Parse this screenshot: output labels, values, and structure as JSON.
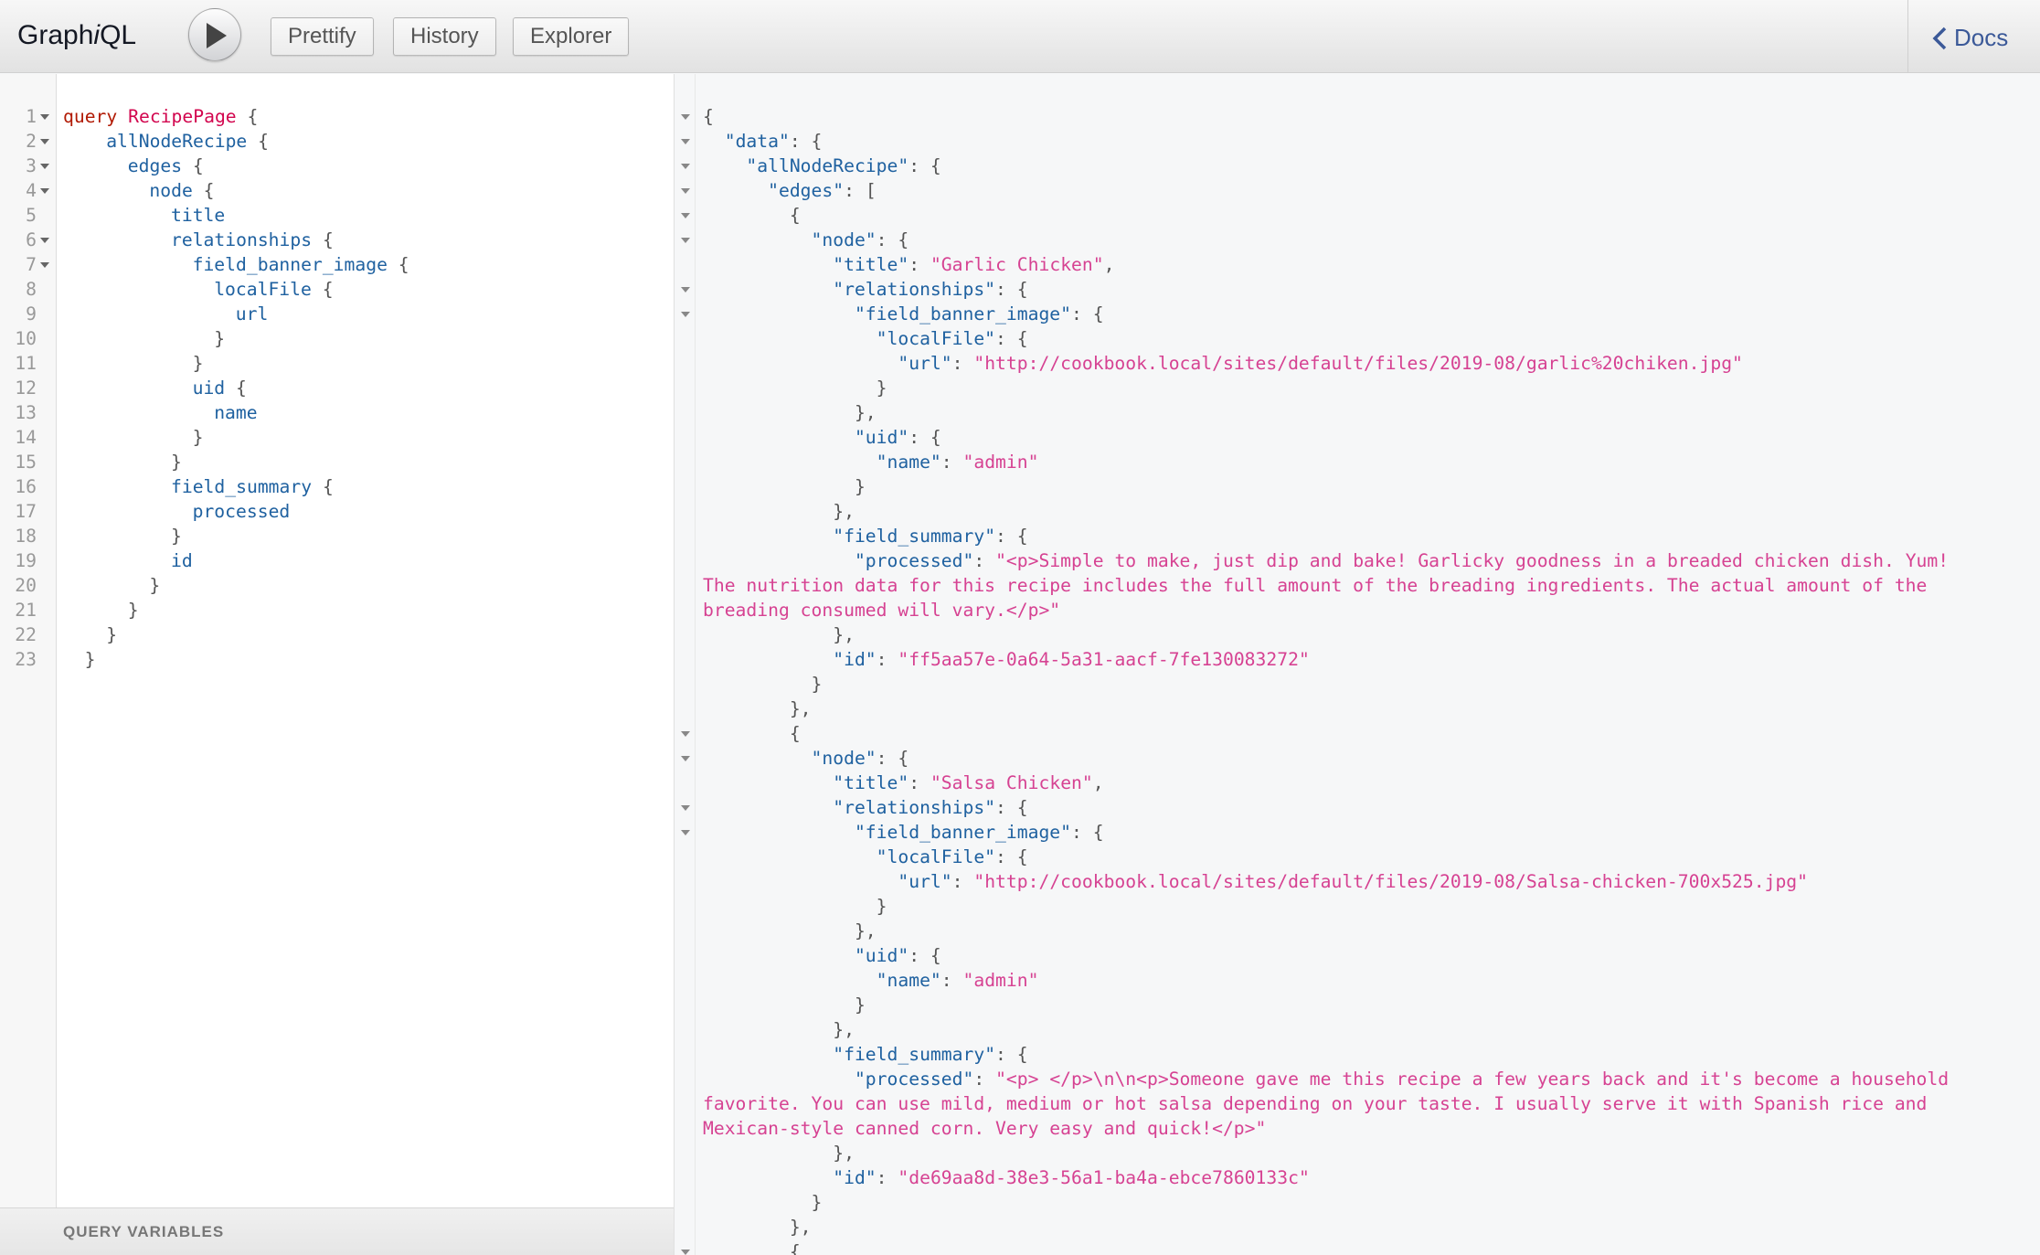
{
  "toolbar": {
    "logo_prefix": "Graph",
    "logo_italic": "i",
    "logo_suffix": "QL",
    "prettify": "Prettify",
    "history": "History",
    "explorer": "Explorer",
    "docs": "Docs"
  },
  "query_lines": [
    {
      "n": "1",
      "fold": true,
      "indent": 0,
      "parts": [
        {
          "t": "query",
          "c": "kw"
        },
        {
          "t": " "
        },
        {
          "t": "RecipePage",
          "c": "def"
        },
        {
          "t": " {"
        }
      ]
    },
    {
      "n": "2",
      "fold": true,
      "indent": 2,
      "parts": [
        {
          "t": "allNodeRecipe",
          "c": "prop"
        },
        {
          "t": " {"
        }
      ]
    },
    {
      "n": "3",
      "fold": true,
      "indent": 3,
      "parts": [
        {
          "t": "edges",
          "c": "prop"
        },
        {
          "t": " {"
        }
      ]
    },
    {
      "n": "4",
      "fold": true,
      "indent": 4,
      "parts": [
        {
          "t": "node",
          "c": "prop"
        },
        {
          "t": " {"
        }
      ]
    },
    {
      "n": "5",
      "fold": false,
      "indent": 5,
      "parts": [
        {
          "t": "title",
          "c": "prop"
        }
      ]
    },
    {
      "n": "6",
      "fold": true,
      "indent": 5,
      "parts": [
        {
          "t": "relationships",
          "c": "prop"
        },
        {
          "t": " {"
        }
      ]
    },
    {
      "n": "7",
      "fold": true,
      "indent": 6,
      "parts": [
        {
          "t": "field_banner_image",
          "c": "prop"
        },
        {
          "t": " {"
        }
      ]
    },
    {
      "n": "8",
      "fold": false,
      "indent": 7,
      "parts": [
        {
          "t": "localFile",
          "c": "prop"
        },
        {
          "t": " {"
        }
      ]
    },
    {
      "n": "9",
      "fold": false,
      "indent": 8,
      "parts": [
        {
          "t": "url",
          "c": "prop"
        }
      ]
    },
    {
      "n": "10",
      "fold": false,
      "indent": 7,
      "parts": [
        {
          "t": "}"
        }
      ]
    },
    {
      "n": "11",
      "fold": false,
      "indent": 6,
      "parts": [
        {
          "t": "}"
        }
      ]
    },
    {
      "n": "12",
      "fold": false,
      "indent": 6,
      "parts": [
        {
          "t": "uid",
          "c": "prop"
        },
        {
          "t": " {"
        }
      ]
    },
    {
      "n": "13",
      "fold": false,
      "indent": 7,
      "parts": [
        {
          "t": "name",
          "c": "prop"
        }
      ]
    },
    {
      "n": "14",
      "fold": false,
      "indent": 6,
      "parts": [
        {
          "t": "}"
        }
      ]
    },
    {
      "n": "15",
      "fold": false,
      "indent": 5,
      "parts": [
        {
          "t": "}"
        }
      ]
    },
    {
      "n": "16",
      "fold": false,
      "indent": 5,
      "parts": [
        {
          "t": "field_summary",
          "c": "prop"
        },
        {
          "t": " {"
        }
      ]
    },
    {
      "n": "17",
      "fold": false,
      "indent": 6,
      "parts": [
        {
          "t": "processed",
          "c": "prop"
        }
      ]
    },
    {
      "n": "18",
      "fold": false,
      "indent": 5,
      "parts": [
        {
          "t": "}"
        }
      ]
    },
    {
      "n": "19",
      "fold": false,
      "indent": 5,
      "parts": [
        {
          "t": "id",
          "c": "prop"
        }
      ]
    },
    {
      "n": "20",
      "fold": false,
      "indent": 4,
      "parts": [
        {
          "t": "}"
        }
      ]
    },
    {
      "n": "21",
      "fold": false,
      "indent": 3,
      "parts": [
        {
          "t": "}"
        }
      ]
    },
    {
      "n": "22",
      "fold": false,
      "indent": 2,
      "parts": [
        {
          "t": "}"
        }
      ]
    },
    {
      "n": "23",
      "fold": false,
      "indent": 1,
      "parts": [
        {
          "t": "}"
        }
      ]
    }
  ],
  "query_variables_label": "QUERY VARIABLES",
  "result_lines": [
    {
      "fold": true,
      "parts": [
        {
          "t": "{"
        }
      ]
    },
    {
      "fold": true,
      "parts": [
        {
          "t": "  "
        },
        {
          "t": "\"data\"",
          "c": "k"
        },
        {
          "t": ": {"
        }
      ]
    },
    {
      "fold": true,
      "parts": [
        {
          "t": "    "
        },
        {
          "t": "\"allNodeRecipe\"",
          "c": "k"
        },
        {
          "t": ": {"
        }
      ]
    },
    {
      "fold": true,
      "parts": [
        {
          "t": "      "
        },
        {
          "t": "\"edges\"",
          "c": "k"
        },
        {
          "t": ": ["
        }
      ]
    },
    {
      "fold": true,
      "parts": [
        {
          "t": "        {"
        }
      ]
    },
    {
      "fold": true,
      "parts": [
        {
          "t": "          "
        },
        {
          "t": "\"node\"",
          "c": "k"
        },
        {
          "t": ": {"
        }
      ]
    },
    {
      "fold": false,
      "parts": [
        {
          "t": "            "
        },
        {
          "t": "\"title\"",
          "c": "k"
        },
        {
          "t": ": "
        },
        {
          "t": "\"Garlic Chicken\"",
          "c": "s"
        },
        {
          "t": ","
        }
      ]
    },
    {
      "fold": true,
      "parts": [
        {
          "t": "            "
        },
        {
          "t": "\"relationships\"",
          "c": "k"
        },
        {
          "t": ": {"
        }
      ]
    },
    {
      "fold": true,
      "parts": [
        {
          "t": "              "
        },
        {
          "t": "\"field_banner_image\"",
          "c": "k"
        },
        {
          "t": ": {"
        }
      ]
    },
    {
      "fold": false,
      "parts": [
        {
          "t": "                "
        },
        {
          "t": "\"localFile\"",
          "c": "k"
        },
        {
          "t": ": {"
        }
      ]
    },
    {
      "fold": false,
      "parts": [
        {
          "t": "                  "
        },
        {
          "t": "\"url\"",
          "c": "k"
        },
        {
          "t": ": "
        },
        {
          "t": "\"http://cookbook.local/sites/default/files/2019-08/garlic%20chiken.jpg\"",
          "c": "s"
        }
      ]
    },
    {
      "fold": false,
      "parts": [
        {
          "t": "                }"
        }
      ]
    },
    {
      "fold": false,
      "parts": [
        {
          "t": "              },"
        }
      ]
    },
    {
      "fold": false,
      "parts": [
        {
          "t": "              "
        },
        {
          "t": "\"uid\"",
          "c": "k"
        },
        {
          "t": ": {"
        }
      ]
    },
    {
      "fold": false,
      "parts": [
        {
          "t": "                "
        },
        {
          "t": "\"name\"",
          "c": "k"
        },
        {
          "t": ": "
        },
        {
          "t": "\"admin\"",
          "c": "s"
        }
      ]
    },
    {
      "fold": false,
      "parts": [
        {
          "t": "              }"
        }
      ]
    },
    {
      "fold": false,
      "parts": [
        {
          "t": "            },"
        }
      ]
    },
    {
      "fold": false,
      "parts": [
        {
          "t": "            "
        },
        {
          "t": "\"field_summary\"",
          "c": "k"
        },
        {
          "t": ": {"
        }
      ]
    },
    {
      "fold": false,
      "parts": [
        {
          "t": "              "
        },
        {
          "t": "\"processed\"",
          "c": "k"
        },
        {
          "t": ": "
        },
        {
          "t": "\"<p>Simple to make, just dip and bake! Garlicky goodness in a breaded chicken dish. Yum!",
          "c": "s"
        }
      ]
    },
    {
      "fold": false,
      "parts": [
        {
          "t": "The nutrition data for this recipe includes the full amount of the breading ingredients. The actual amount of the",
          "c": "s"
        }
      ]
    },
    {
      "fold": false,
      "parts": [
        {
          "t": "breading consumed will vary.</p>\"",
          "c": "s"
        }
      ]
    },
    {
      "fold": false,
      "parts": [
        {
          "t": "            },"
        }
      ]
    },
    {
      "fold": false,
      "parts": [
        {
          "t": "            "
        },
        {
          "t": "\"id\"",
          "c": "k"
        },
        {
          "t": ": "
        },
        {
          "t": "\"ff5aa57e-0a64-5a31-aacf-7fe130083272\"",
          "c": "s"
        }
      ]
    },
    {
      "fold": false,
      "parts": [
        {
          "t": "          }"
        }
      ]
    },
    {
      "fold": false,
      "parts": [
        {
          "t": "        },"
        }
      ]
    },
    {
      "fold": true,
      "parts": [
        {
          "t": "        {"
        }
      ]
    },
    {
      "fold": true,
      "parts": [
        {
          "t": "          "
        },
        {
          "t": "\"node\"",
          "c": "k"
        },
        {
          "t": ": {"
        }
      ]
    },
    {
      "fold": false,
      "parts": [
        {
          "t": "            "
        },
        {
          "t": "\"title\"",
          "c": "k"
        },
        {
          "t": ": "
        },
        {
          "t": "\"Salsa Chicken\"",
          "c": "s"
        },
        {
          "t": ","
        }
      ]
    },
    {
      "fold": true,
      "parts": [
        {
          "t": "            "
        },
        {
          "t": "\"relationships\"",
          "c": "k"
        },
        {
          "t": ": {"
        }
      ]
    },
    {
      "fold": true,
      "parts": [
        {
          "t": "              "
        },
        {
          "t": "\"field_banner_image\"",
          "c": "k"
        },
        {
          "t": ": {"
        }
      ]
    },
    {
      "fold": false,
      "parts": [
        {
          "t": "                "
        },
        {
          "t": "\"localFile\"",
          "c": "k"
        },
        {
          "t": ": {"
        }
      ]
    },
    {
      "fold": false,
      "parts": [
        {
          "t": "                  "
        },
        {
          "t": "\"url\"",
          "c": "k"
        },
        {
          "t": ": "
        },
        {
          "t": "\"http://cookbook.local/sites/default/files/2019-08/Salsa-chicken-700x525.jpg\"",
          "c": "s"
        }
      ]
    },
    {
      "fold": false,
      "parts": [
        {
          "t": "                }"
        }
      ]
    },
    {
      "fold": false,
      "parts": [
        {
          "t": "              },"
        }
      ]
    },
    {
      "fold": false,
      "parts": [
        {
          "t": "              "
        },
        {
          "t": "\"uid\"",
          "c": "k"
        },
        {
          "t": ": {"
        }
      ]
    },
    {
      "fold": false,
      "parts": [
        {
          "t": "                "
        },
        {
          "t": "\"name\"",
          "c": "k"
        },
        {
          "t": ": "
        },
        {
          "t": "\"admin\"",
          "c": "s"
        }
      ]
    },
    {
      "fold": false,
      "parts": [
        {
          "t": "              }"
        }
      ]
    },
    {
      "fold": false,
      "parts": [
        {
          "t": "            },"
        }
      ]
    },
    {
      "fold": false,
      "parts": [
        {
          "t": "            "
        },
        {
          "t": "\"field_summary\"",
          "c": "k"
        },
        {
          "t": ": {"
        }
      ]
    },
    {
      "fold": false,
      "parts": [
        {
          "t": "              "
        },
        {
          "t": "\"processed\"",
          "c": "k"
        },
        {
          "t": ": "
        },
        {
          "t": "\"<p> </p>\\n\\n<p>Someone gave me this recipe a few years back and it's become a household",
          "c": "s"
        }
      ]
    },
    {
      "fold": false,
      "parts": [
        {
          "t": "favorite. You can use mild, medium or hot salsa depending on your taste. I usually serve it with Spanish rice and",
          "c": "s"
        }
      ]
    },
    {
      "fold": false,
      "parts": [
        {
          "t": "Mexican-style canned corn. Very easy and quick!</p>\"",
          "c": "s"
        }
      ]
    },
    {
      "fold": false,
      "parts": [
        {
          "t": "            },"
        }
      ]
    },
    {
      "fold": false,
      "parts": [
        {
          "t": "            "
        },
        {
          "t": "\"id\"",
          "c": "k"
        },
        {
          "t": ": "
        },
        {
          "t": "\"de69aa8d-38e3-56a1-ba4a-ebce7860133c\"",
          "c": "s"
        }
      ]
    },
    {
      "fold": false,
      "parts": [
        {
          "t": "          }"
        }
      ]
    },
    {
      "fold": false,
      "parts": [
        {
          "t": "        },"
        }
      ]
    },
    {
      "fold": true,
      "parts": [
        {
          "t": "        {"
        }
      ]
    }
  ],
  "colors": {
    "keyword": "#b11a04",
    "definition": "#d2054e",
    "property": "#1f61a0",
    "string": "#d64292",
    "docs_link": "#3b5998"
  }
}
